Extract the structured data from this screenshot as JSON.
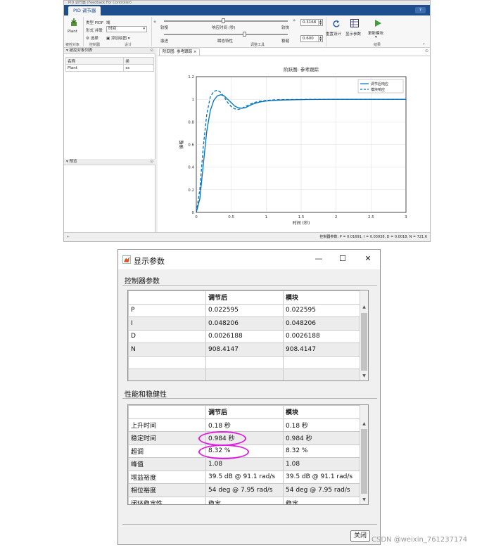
{
  "app": {
    "title": "PID 调节器 (Feedback For Controller)",
    "tab": "PID 调节器",
    "help_label": "?",
    "ribbon": {
      "plant_label": "Plant",
      "type_label": "类型 PIDF",
      "type_value": "域",
      "form_label": "形式 并联",
      "domain_value": "时间",
      "select_label": "选择",
      "add_plot_label": "添加绘图",
      "group_plant": "被控对象",
      "group_controller": "控制器",
      "group_design": "设计",
      "slow_label": "较慢",
      "fast_label": "较快",
      "response_time_label": "响应时间 (秒)",
      "aggressive_label": "激进",
      "robust_label": "稳健",
      "transient_label": "瞬态特性",
      "response_time_value": "0.3168",
      "transient_value": "0.600",
      "group_tune": "调整工具",
      "reset_label": "重置设计",
      "show_params_label": "显示参数",
      "update_label": "更新模块",
      "group_results": "结果"
    },
    "left_panel": {
      "header": "被控对象列表",
      "col_name": "名称",
      "col_type": "类",
      "row_name": "Plant",
      "row_type": "ss",
      "preview_header": "预览"
    },
    "plot": {
      "tab_label": "阶跃图: 参考跟踪",
      "status": "控制器参数: P = 0.01691, I = 0.03938, D = 0.0018, N = 721.6"
    }
  },
  "chart_data": {
    "type": "line",
    "title": "阶跃图: 参考跟踪",
    "xlabel": "时间 (秒)",
    "ylabel": "振幅",
    "xlim": [
      0,
      3
    ],
    "ylim": [
      0,
      1.2
    ],
    "xticks": [
      "0",
      "0.5",
      "1",
      "1.5",
      "2",
      "2.5",
      "3"
    ],
    "yticks": [
      "0",
      "0.2",
      "0.4",
      "0.6",
      "0.8",
      "1",
      "1.2"
    ],
    "grid": true,
    "legend_position": "top-right",
    "series": [
      {
        "name": "调节后响应",
        "style": "solid",
        "color": "#0072bd",
        "x": [
          0,
          0.05,
          0.1,
          0.15,
          0.2,
          0.25,
          0.3,
          0.35,
          0.4,
          0.45,
          0.5,
          0.55,
          0.6,
          0.65,
          0.7,
          0.75,
          0.8,
          0.85,
          0.9,
          1.0,
          1.1,
          1.2,
          1.4,
          1.6,
          2.0,
          2.5,
          3.0
        ],
        "y": [
          0,
          0.12,
          0.42,
          0.72,
          0.9,
          0.99,
          1.03,
          1.04,
          1.03,
          1.0,
          0.97,
          0.94,
          0.925,
          0.92,
          0.925,
          0.94,
          0.955,
          0.965,
          0.975,
          0.985,
          0.99,
          0.993,
          0.996,
          0.998,
          1.0,
          1.0,
          1.0
        ]
      },
      {
        "name": "模块响应",
        "style": "dashed",
        "color": "#0072bd",
        "x": [
          0,
          0.05,
          0.1,
          0.15,
          0.2,
          0.25,
          0.3,
          0.35,
          0.4,
          0.45,
          0.5,
          0.55,
          0.6,
          0.65,
          0.7,
          0.75,
          0.8,
          0.85,
          0.9,
          1.0,
          1.1,
          1.2,
          1.4,
          1.6,
          2.0,
          2.5,
          3.0
        ],
        "y": [
          0,
          0.2,
          0.58,
          0.87,
          1.02,
          1.07,
          1.08,
          1.06,
          1.02,
          0.97,
          0.935,
          0.915,
          0.91,
          0.92,
          0.935,
          0.95,
          0.965,
          0.975,
          0.982,
          0.99,
          0.994,
          0.997,
          0.998,
          0.999,
          1.0,
          1.0,
          1.0
        ]
      }
    ]
  },
  "dialog": {
    "title": "显示参数",
    "minimize_label": "—",
    "maximize_label": "☐",
    "close_label": "✕",
    "controller_section": "控制器参数",
    "controller_headers": [
      "",
      "调节后",
      "模块"
    ],
    "controller_rows": [
      {
        "name": "P",
        "tuned": "0.022595",
        "block": "0.022595"
      },
      {
        "name": "I",
        "tuned": "0.048206",
        "block": "0.048206"
      },
      {
        "name": "D",
        "tuned": "0.0026188",
        "block": "0.0026188"
      },
      {
        "name": "N",
        "tuned": "908.4147",
        "block": "908.4147"
      },
      {
        "name": "",
        "tuned": "",
        "block": ""
      },
      {
        "name": "",
        "tuned": "",
        "block": ""
      }
    ],
    "performance_section": "性能和稳健性",
    "performance_headers": [
      "",
      "调节后",
      "模块"
    ],
    "performance_rows": [
      {
        "name": "上升时间",
        "tuned": "0.18 秒",
        "block": "0.18 秒"
      },
      {
        "name": "稳定时间",
        "tuned": "0.984 秒",
        "block": "0.984 秒"
      },
      {
        "name": "超调",
        "tuned": "8.32 %",
        "block": "8.32 %"
      },
      {
        "name": "峰值",
        "tuned": "1.08",
        "block": "1.08"
      },
      {
        "name": "增益裕度",
        "tuned": "39.5 dB @ 91.1 rad/s",
        "block": "39.5 dB @ 91.1 rad/s"
      },
      {
        "name": "相位裕度",
        "tuned": "54 deg @ 7.95 rad/s",
        "block": "54 deg @ 7.95 rad/s"
      },
      {
        "name": "闭环稳定性",
        "tuned": "稳定",
        "block": "稳定"
      }
    ],
    "close_button": "关闭"
  },
  "watermark": "CSDN @weixin_761237174"
}
